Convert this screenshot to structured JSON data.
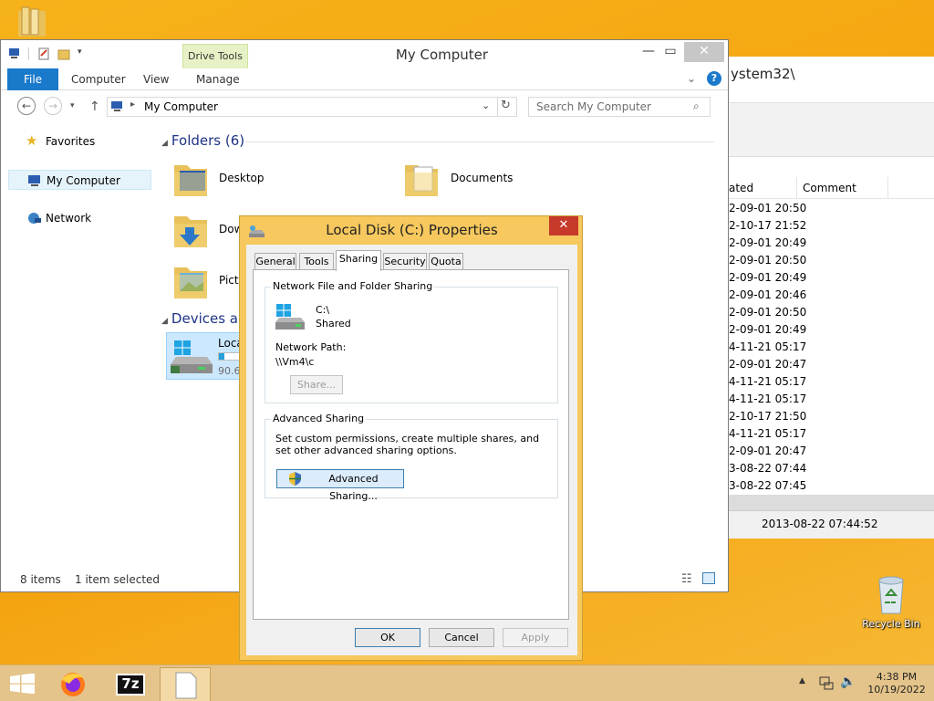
{
  "background_window": {
    "title": "ystem32\\",
    "columns": [
      "ated",
      "Comment"
    ],
    "rows": [
      "2-09-01 20:50",
      "2-10-17 21:52",
      "2-09-01 20:49",
      "2-09-01 20:50",
      "2-09-01 20:49",
      "2-09-01 20:46",
      "2-09-01 20:50",
      "2-09-01 20:49",
      "4-11-21 05:17",
      "2-09-01 20:47",
      "4-11-21 05:17",
      "4-11-21 05:17",
      "2-10-17 21:50",
      "4-11-21 05:17",
      "2-09-01 20:47",
      "3-08-22 07:44",
      "3-08-22 07:45"
    ],
    "footer_value": "2013-08-22 07:44:52"
  },
  "explorer": {
    "title": "My Computer",
    "contextual_tab": "Drive Tools",
    "ribbon_tabs": [
      "File",
      "Computer",
      "View",
      "Manage"
    ],
    "address": "My Computer",
    "search_placeholder": "Search My Computer",
    "nav": {
      "favorites": "Favorites",
      "my_computer": "My Computer",
      "network": "Network"
    },
    "folders_header": "Folders (6)",
    "folders": [
      "Desktop",
      "Documents",
      "Dow",
      "Pictu"
    ],
    "devices_header": "Devices and",
    "drive": {
      "name": "Loca",
      "size": "90.6",
      "used_fraction": 0.28
    },
    "status": {
      "count": "8 items",
      "selected": "1 item selected"
    }
  },
  "dialog": {
    "title": "Local Disk (C:) Properties",
    "tabs": [
      "General",
      "Tools",
      "Sharing",
      "Security",
      "Quota"
    ],
    "active_tab": "Sharing",
    "network_group_label": "Network File and Folder Sharing",
    "drive_path": "C:\\",
    "share_state": "Shared",
    "network_path_label": "Network Path:",
    "network_path": "\\\\Vm4\\c",
    "share_button": "Share...",
    "advanced_group_label": "Advanced Sharing",
    "advanced_description": "Set custom permissions, create multiple shares, and set other advanced sharing options.",
    "advanced_button": "Advanced Sharing...",
    "ok": "OK",
    "cancel": "Cancel",
    "apply": "Apply"
  },
  "desktop": {
    "recycle_bin": "Recycle Bin"
  },
  "taskbar": {
    "time": "4:38 PM",
    "date": "10/19/2022",
    "seven_zip": "7z"
  },
  "colors": {
    "accent_blue": "#1979ca",
    "desktop_orange": "#f4a20e",
    "dialog_frame": "#f6c85e",
    "close_red": "#c6392b"
  }
}
